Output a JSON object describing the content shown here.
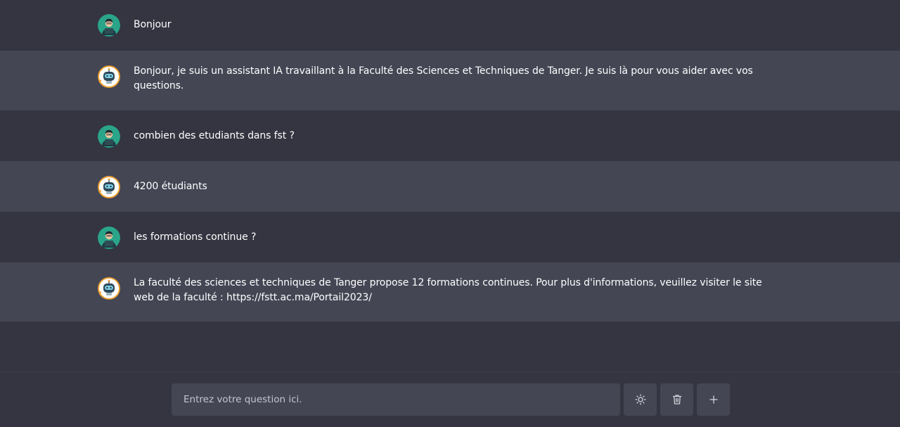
{
  "messages": [
    {
      "role": "user",
      "text": "Bonjour"
    },
    {
      "role": "bot",
      "text": "Bonjour, je suis un assistant IA travaillant à la Faculté des Sciences et Techniques de Tanger. Je suis là pour vous aider avec vos questions."
    },
    {
      "role": "user",
      "text": "combien des etudiants dans fst ?"
    },
    {
      "role": "bot",
      "text": "4200 étudiants"
    },
    {
      "role": "user",
      "text": "les formations continue ?"
    },
    {
      "role": "bot",
      "text": "La faculté des sciences et techniques de Tanger propose 12 formations continues. Pour plus d'informations, veuillez visiter le site web de la faculté : https://fstt.ac.ma/Portail2023/"
    }
  ],
  "composer": {
    "placeholder": "Entrez votre question ici.",
    "value": ""
  },
  "icons": {
    "user_avatar": "user-avatar-icon",
    "bot_avatar": "robot-avatar-icon",
    "theme": "sun-icon",
    "delete": "trash-icon",
    "new": "plus-icon"
  },
  "colors": {
    "background": "#343541",
    "bot_row": "#444654",
    "user_avatar_bg": "#2aa58a",
    "bot_avatar_accent": "#f0a030",
    "text": "#ffffff"
  }
}
